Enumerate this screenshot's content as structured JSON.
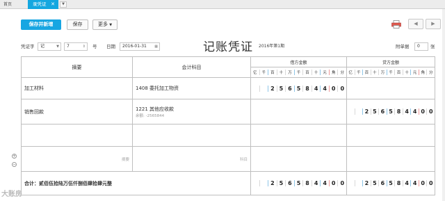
{
  "tabs": {
    "home": "首页",
    "active": "录凭证"
  },
  "toolbar": {
    "save_new": "保存并新增",
    "save": "保存",
    "more": "更多"
  },
  "form": {
    "voucher_word_label": "凭证字",
    "voucher_word": "记",
    "number": "7",
    "number_suffix": "号",
    "date_label": "日期",
    "date": "2016-01-31",
    "title": "记账凭证",
    "period": "2016年第1期",
    "attachments_label": "附单据",
    "attachments": "0",
    "attachments_unit": "张"
  },
  "table": {
    "col_summary": "摘要",
    "col_account": "会计科目",
    "col_debit": "借方金额",
    "col_credit": "贷方金额",
    "digit_units": [
      "亿",
      "千",
      "百",
      "十",
      "万",
      "千",
      "百",
      "十",
      "元",
      "角",
      "分"
    ],
    "rows": [
      {
        "summary": "加工材料",
        "account": "1408 委托加工物资",
        "account_note": "",
        "debit": [
          "",
          "",
          "2",
          "5",
          "6",
          "5",
          "8",
          "4",
          "4",
          "0",
          "0"
        ],
        "credit": [
          "",
          "",
          "",
          "",
          "",
          "",
          "",
          "",
          "",
          "",
          ""
        ]
      },
      {
        "summary": "销售回款",
        "account": "1221 其他应收款",
        "account_note": "余额: -2565844",
        "debit": [
          "",
          "",
          "",
          "",
          "",
          "",
          "",
          "",
          "",
          "",
          ""
        ],
        "credit": [
          "",
          "",
          "2",
          "5",
          "6",
          "5",
          "8",
          "4",
          "4",
          "0",
          "0"
        ]
      },
      {
        "summary": "",
        "account": "",
        "account_note": "",
        "debit": [
          "",
          "",
          "",
          "",
          "",
          "",
          "",
          "",
          "",
          "",
          ""
        ],
        "credit": [
          "",
          "",
          "",
          "",
          "",
          "",
          "",
          "",
          "",
          "",
          ""
        ]
      },
      {
        "summary": "",
        "summary_placeholder": "摘要",
        "account": "",
        "account_placeholder": "科目",
        "account_note": "",
        "debit": [
          "",
          "",
          "",
          "",
          "",
          "",
          "",
          "",
          "",
          "",
          ""
        ],
        "credit": [
          "",
          "",
          "",
          "",
          "",
          "",
          "",
          "",
          "",
          "",
          ""
        ]
      }
    ],
    "total_label": "合计：贰佰伍拾陆万伍仟捌佰肆拾肆元整",
    "total_debit": [
      "",
      "",
      "2",
      "5",
      "6",
      "5",
      "8",
      "4",
      "4",
      "0",
      "0"
    ],
    "total_credit": [
      "",
      "",
      "2",
      "5",
      "6",
      "5",
      "8",
      "4",
      "4",
      "0",
      "0"
    ]
  },
  "watermark": "大账房"
}
